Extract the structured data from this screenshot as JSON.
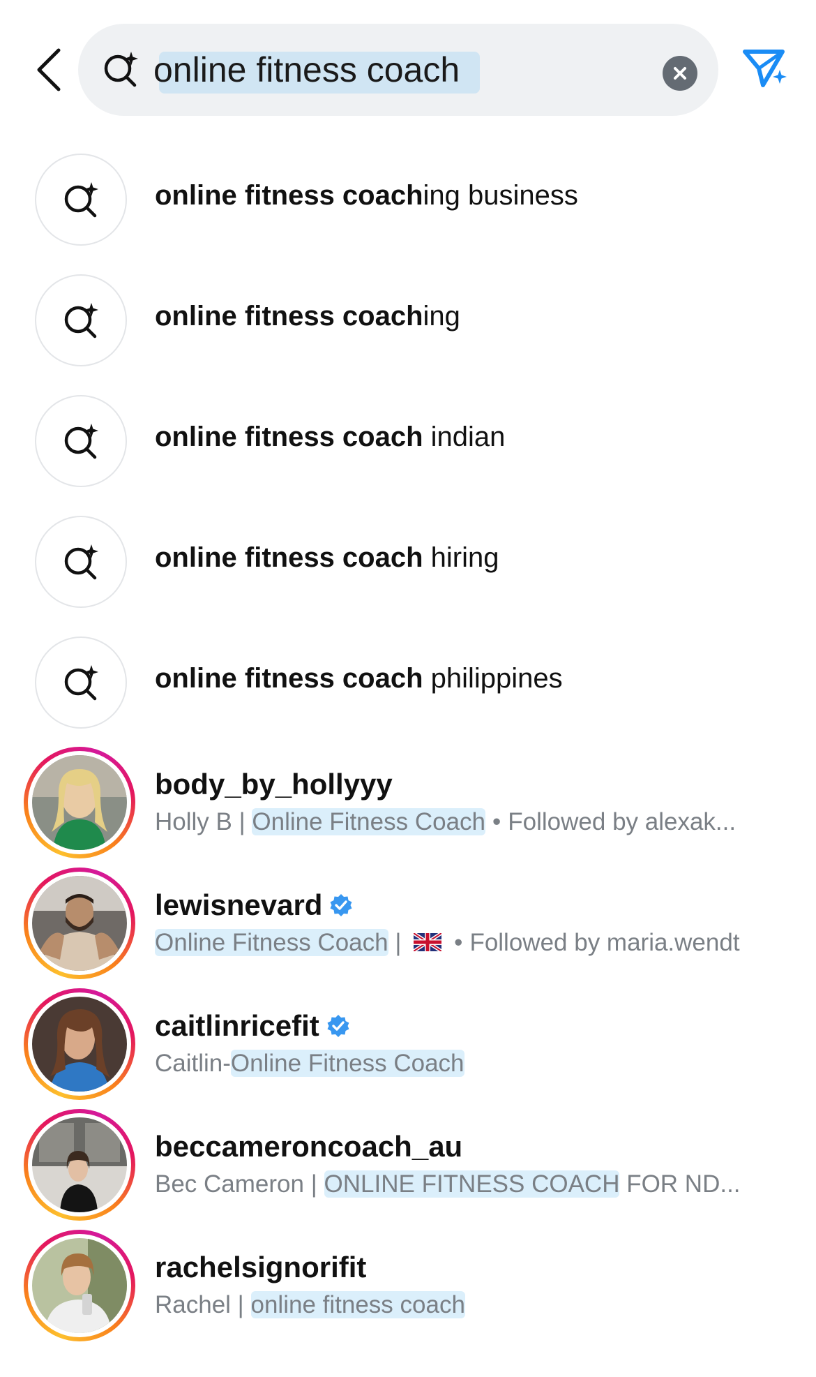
{
  "search": {
    "query": "online fitness coach",
    "icons": {
      "back": "chevron-left-icon",
      "search": "ai-search-icon",
      "clear": "clear-icon",
      "send": "send-sparkle-icon"
    },
    "accent": "#1a8cf5"
  },
  "suggestions": [
    {
      "bold": "online fitness coach",
      "rest": "ing business"
    },
    {
      "bold": "online fitness coach",
      "rest": "ing"
    },
    {
      "bold": "online fitness coach",
      "rest": " indian"
    },
    {
      "bold": "online fitness coach",
      "rest": " hiring"
    },
    {
      "bold": "online fitness coach",
      "rest": " philippines"
    }
  ],
  "accounts": [
    {
      "username": "body_by_hollyyy",
      "verified": false,
      "sub_pre": "Holly B | ",
      "sub_hl": "Online Fitness Coach",
      "sub_post": "",
      "followed": "Followed by alexak..."
    },
    {
      "username": "lewisnevard",
      "verified": true,
      "sub_pre": "",
      "sub_hl": "Online Fitness Coach",
      "sub_post": " |",
      "flag": "uk-flag",
      "followed": "Followed by maria.wendt"
    },
    {
      "username": "caitlinricefit",
      "verified": true,
      "sub_pre": "Caitlin-",
      "sub_hl": "Online Fitness Coach",
      "sub_post": ""
    },
    {
      "username": "beccameroncoach_au",
      "verified": false,
      "sub_pre": "Bec Cameron | ",
      "sub_hl": "ONLINE FITNESS COACH",
      "sub_post": " FOR ND..."
    },
    {
      "username": "rachelsignorifit",
      "verified": false,
      "sub_pre": "Rachel | ",
      "sub_hl": "online fitness coach",
      "sub_post": ""
    }
  ],
  "separator": "•",
  "colors": {
    "verified": "#3897f0",
    "ring_start": "#fdbf2d",
    "ring_end": "#d4199b",
    "secondary_text": "#7a7f85"
  }
}
